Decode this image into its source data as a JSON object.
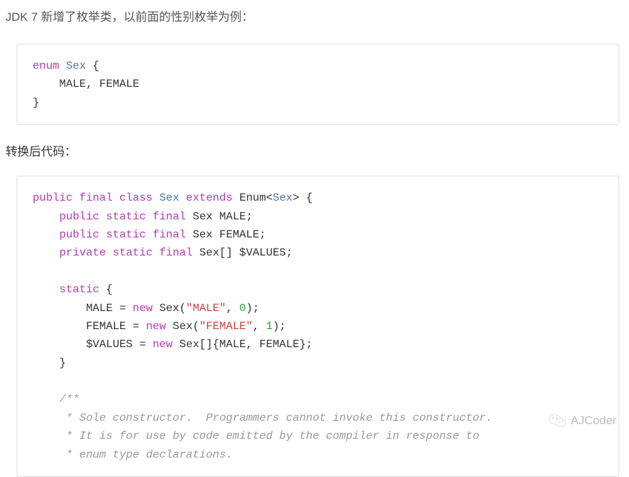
{
  "intro_text": "JDK 7 新增了枚举类，以前面的性别枚举为例：",
  "section_text": "转换后代码：",
  "code1": {
    "kw_enum": "enum",
    "type_sex": "Sex",
    "brace_open": " {",
    "body": "    MALE, FEMALE",
    "brace_close": "}"
  },
  "code2": {
    "line1": {
      "kw_public": "public",
      "kw_final": "final",
      "kw_class": "class",
      "type_sex": "Sex",
      "kw_extends": "extends",
      "text_enum": " Enum<",
      "type_sex2": "Sex",
      "text_end": "> {"
    },
    "line2": {
      "kw_public": "public",
      "kw_static": "static",
      "kw_final": "final",
      "text_end": " Sex MALE;"
    },
    "line3": {
      "kw_public": "public",
      "kw_static": "static",
      "kw_final": "final",
      "text_end": " Sex FEMALE;"
    },
    "line4": {
      "kw_private": "private",
      "kw_static": "static",
      "kw_final": "final",
      "text_end": " Sex[] $VALUES;"
    },
    "line5": {
      "kw_static": "static",
      "text_end": " {"
    },
    "line6": {
      "text_pre": "        MALE = ",
      "kw_new": "new",
      "text_mid": " Sex(",
      "str": "\"MALE\"",
      "text_comma": ", ",
      "num": "0",
      "text_end": ");"
    },
    "line7": {
      "text_pre": "        FEMALE = ",
      "kw_new": "new",
      "text_mid": " Sex(",
      "str": "\"FEMALE\"",
      "text_comma": ", ",
      "num": "1",
      "text_end": ");"
    },
    "line8": {
      "text_pre": "        $VALUES = ",
      "kw_new": "new",
      "text_end": " Sex[]{MALE, FEMALE};"
    },
    "line9": "    }",
    "comment1": "    /**",
    "comment2": "     * Sole constructor.  Programmers cannot invoke this constructor.",
    "comment3": "     * It is for use by code emitted by the compiler in response to",
    "comment4": "     * enum type declarations."
  },
  "watermark": {
    "label": "AJCoder"
  }
}
